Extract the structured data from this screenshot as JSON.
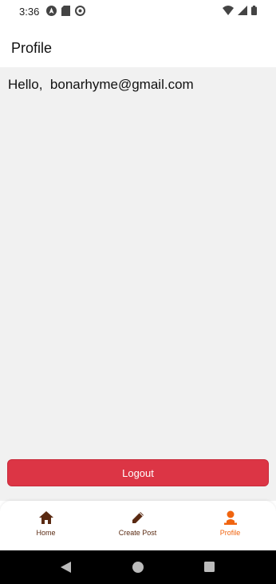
{
  "status_bar": {
    "time": "3:36",
    "left_icons": [
      "navigation-icon",
      "sd-card-icon",
      "sync-icon"
    ],
    "right_icons": [
      "wifi-icon",
      "cell-signal-icon",
      "battery-icon"
    ]
  },
  "app_bar": {
    "title": "Profile"
  },
  "main": {
    "greeting": "Hello,  bonarhyme@gmail.com",
    "logout_label": "Logout"
  },
  "bottom_nav": {
    "items": [
      {
        "label": "Home",
        "icon": "home-icon",
        "active": false
      },
      {
        "label": "Create Post",
        "icon": "pencil-icon",
        "active": false
      },
      {
        "label": "Profile",
        "icon": "person-icon",
        "active": true
      }
    ]
  },
  "colors": {
    "logout": "#dc3545",
    "nav_inactive": "#5a2a12",
    "nav_active": "#f0640f",
    "content_bg": "#f1f1f1"
  }
}
